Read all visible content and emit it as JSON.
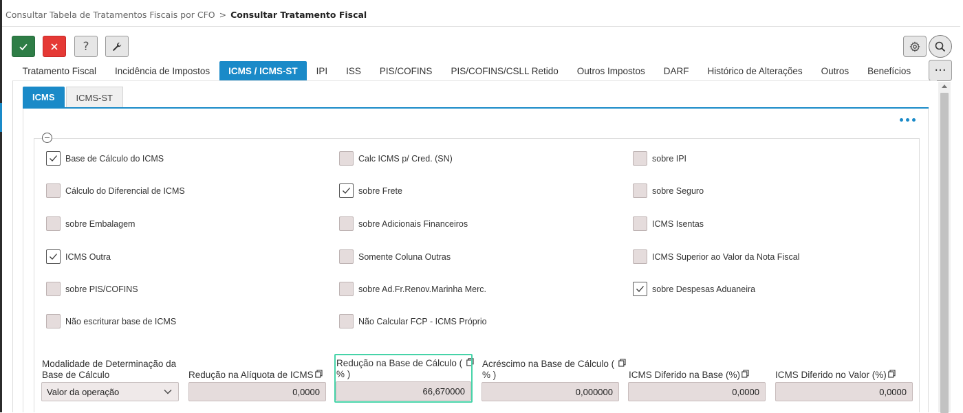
{
  "breadcrumb": {
    "parent": "Consultar Tabela de Tratamentos Fiscais por CFO",
    "separator": ">",
    "current": "Consultar Tratamento Fiscal"
  },
  "toolbar": {
    "help_glyph": "?",
    "more_glyph": "···"
  },
  "tabs": [
    {
      "label": "Tratamento Fiscal"
    },
    {
      "label": "Incidência de Impostos"
    },
    {
      "label": "ICMS / ICMS-ST",
      "active": true
    },
    {
      "label": "IPI"
    },
    {
      "label": "ISS"
    },
    {
      "label": "PIS/COFINS"
    },
    {
      "label": "PIS/COFINS/CSLL Retido"
    },
    {
      "label": "Outros Impostos"
    },
    {
      "label": "DARF"
    },
    {
      "label": "Histórico de Alterações"
    },
    {
      "label": "Outros"
    },
    {
      "label": "Benefícios"
    }
  ],
  "subtabs": [
    {
      "label": "ICMS",
      "active": true
    },
    {
      "label": "ICMS-ST"
    }
  ],
  "checkboxes": [
    {
      "label": "Base de Cálculo do ICMS",
      "checked": true
    },
    {
      "label": "Calc ICMS p/ Cred. (SN)",
      "checked": false
    },
    {
      "label": "sobre IPI",
      "checked": false
    },
    {
      "label": "Cálculo do Diferencial de ICMS",
      "checked": false
    },
    {
      "label": "sobre Frete",
      "checked": true
    },
    {
      "label": "sobre Seguro",
      "checked": false
    },
    {
      "label": "sobre Embalagem",
      "checked": false
    },
    {
      "label": "sobre Adicionais Financeiros",
      "checked": false
    },
    {
      "label": "ICMS Isentas",
      "checked": false
    },
    {
      "label": "ICMS Outra",
      "checked": true
    },
    {
      "label": "Somente Coluna Outras",
      "checked": false
    },
    {
      "label": "ICMS Superior ao Valor da Nota Fiscal",
      "checked": false
    },
    {
      "label": "sobre PIS/COFINS",
      "checked": false
    },
    {
      "label": "sobre Ad.Fr.Renov.Marinha Merc.",
      "checked": false
    },
    {
      "label": "sobre Despesas Aduaneira",
      "checked": true
    },
    {
      "label": "Não escriturar base de ICMS",
      "checked": false
    },
    {
      "label": "Não Calcular FCP - ICMS Próprio",
      "checked": false
    }
  ],
  "fields": {
    "modalidade": {
      "label_line1": "Modalidade de Determinação da",
      "label_line2": "Base de Cálculo",
      "value": "Valor da operação"
    },
    "reducao_aliquota": {
      "label": "Redução na Alíquota de ICMS",
      "value": "0,0000"
    },
    "reducao_base": {
      "label_line1": "Redução na Base de Cálculo (",
      "label_line2": "% )",
      "value": "66,670000"
    },
    "acrescimo_base": {
      "label_line1": "Acréscimo na Base de Cálculo (",
      "label_line2": "% )",
      "value": "0,000000"
    },
    "diferido_base": {
      "label": "ICMS Diferido na Base (%)",
      "value": "0,0000"
    },
    "diferido_valor": {
      "label": "ICMS Diferido no Valor (%)",
      "value": "0,0000"
    }
  },
  "colors": {
    "accent": "#1a8ac8",
    "ok": "#2e7d46",
    "cancel": "#e53935",
    "focus": "#46d3a8"
  }
}
